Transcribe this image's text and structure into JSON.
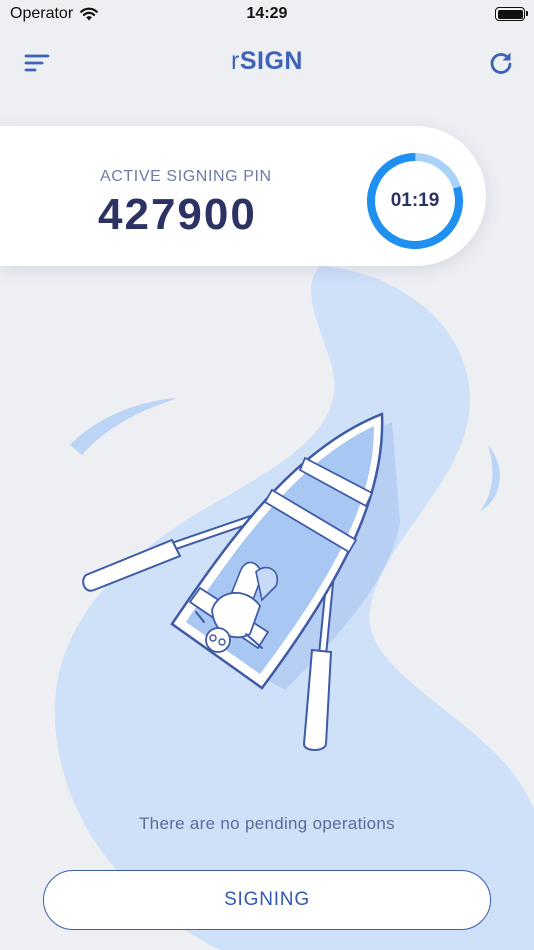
{
  "status_bar": {
    "carrier": "Operator",
    "time": "14:29"
  },
  "header": {
    "title_prefix": "r",
    "title_main": "SIGN",
    "menu_icon": "hamburger-menu-icon",
    "refresh_icon": "refresh-icon"
  },
  "pin_card": {
    "label": "ACTIVE SIGNING PIN",
    "pin": "427900",
    "timer": "01:19",
    "timer_progress": 0.8
  },
  "main": {
    "empty_message": "There are no pending operations"
  },
  "footer": {
    "signing_button": "SIGNING"
  },
  "colors": {
    "accent": "#3d62b8",
    "timer_ring": "#1f8ff0",
    "timer_ring_track": "#a9d2fb",
    "water": "#cfe0f9",
    "background": "#edeff3"
  }
}
